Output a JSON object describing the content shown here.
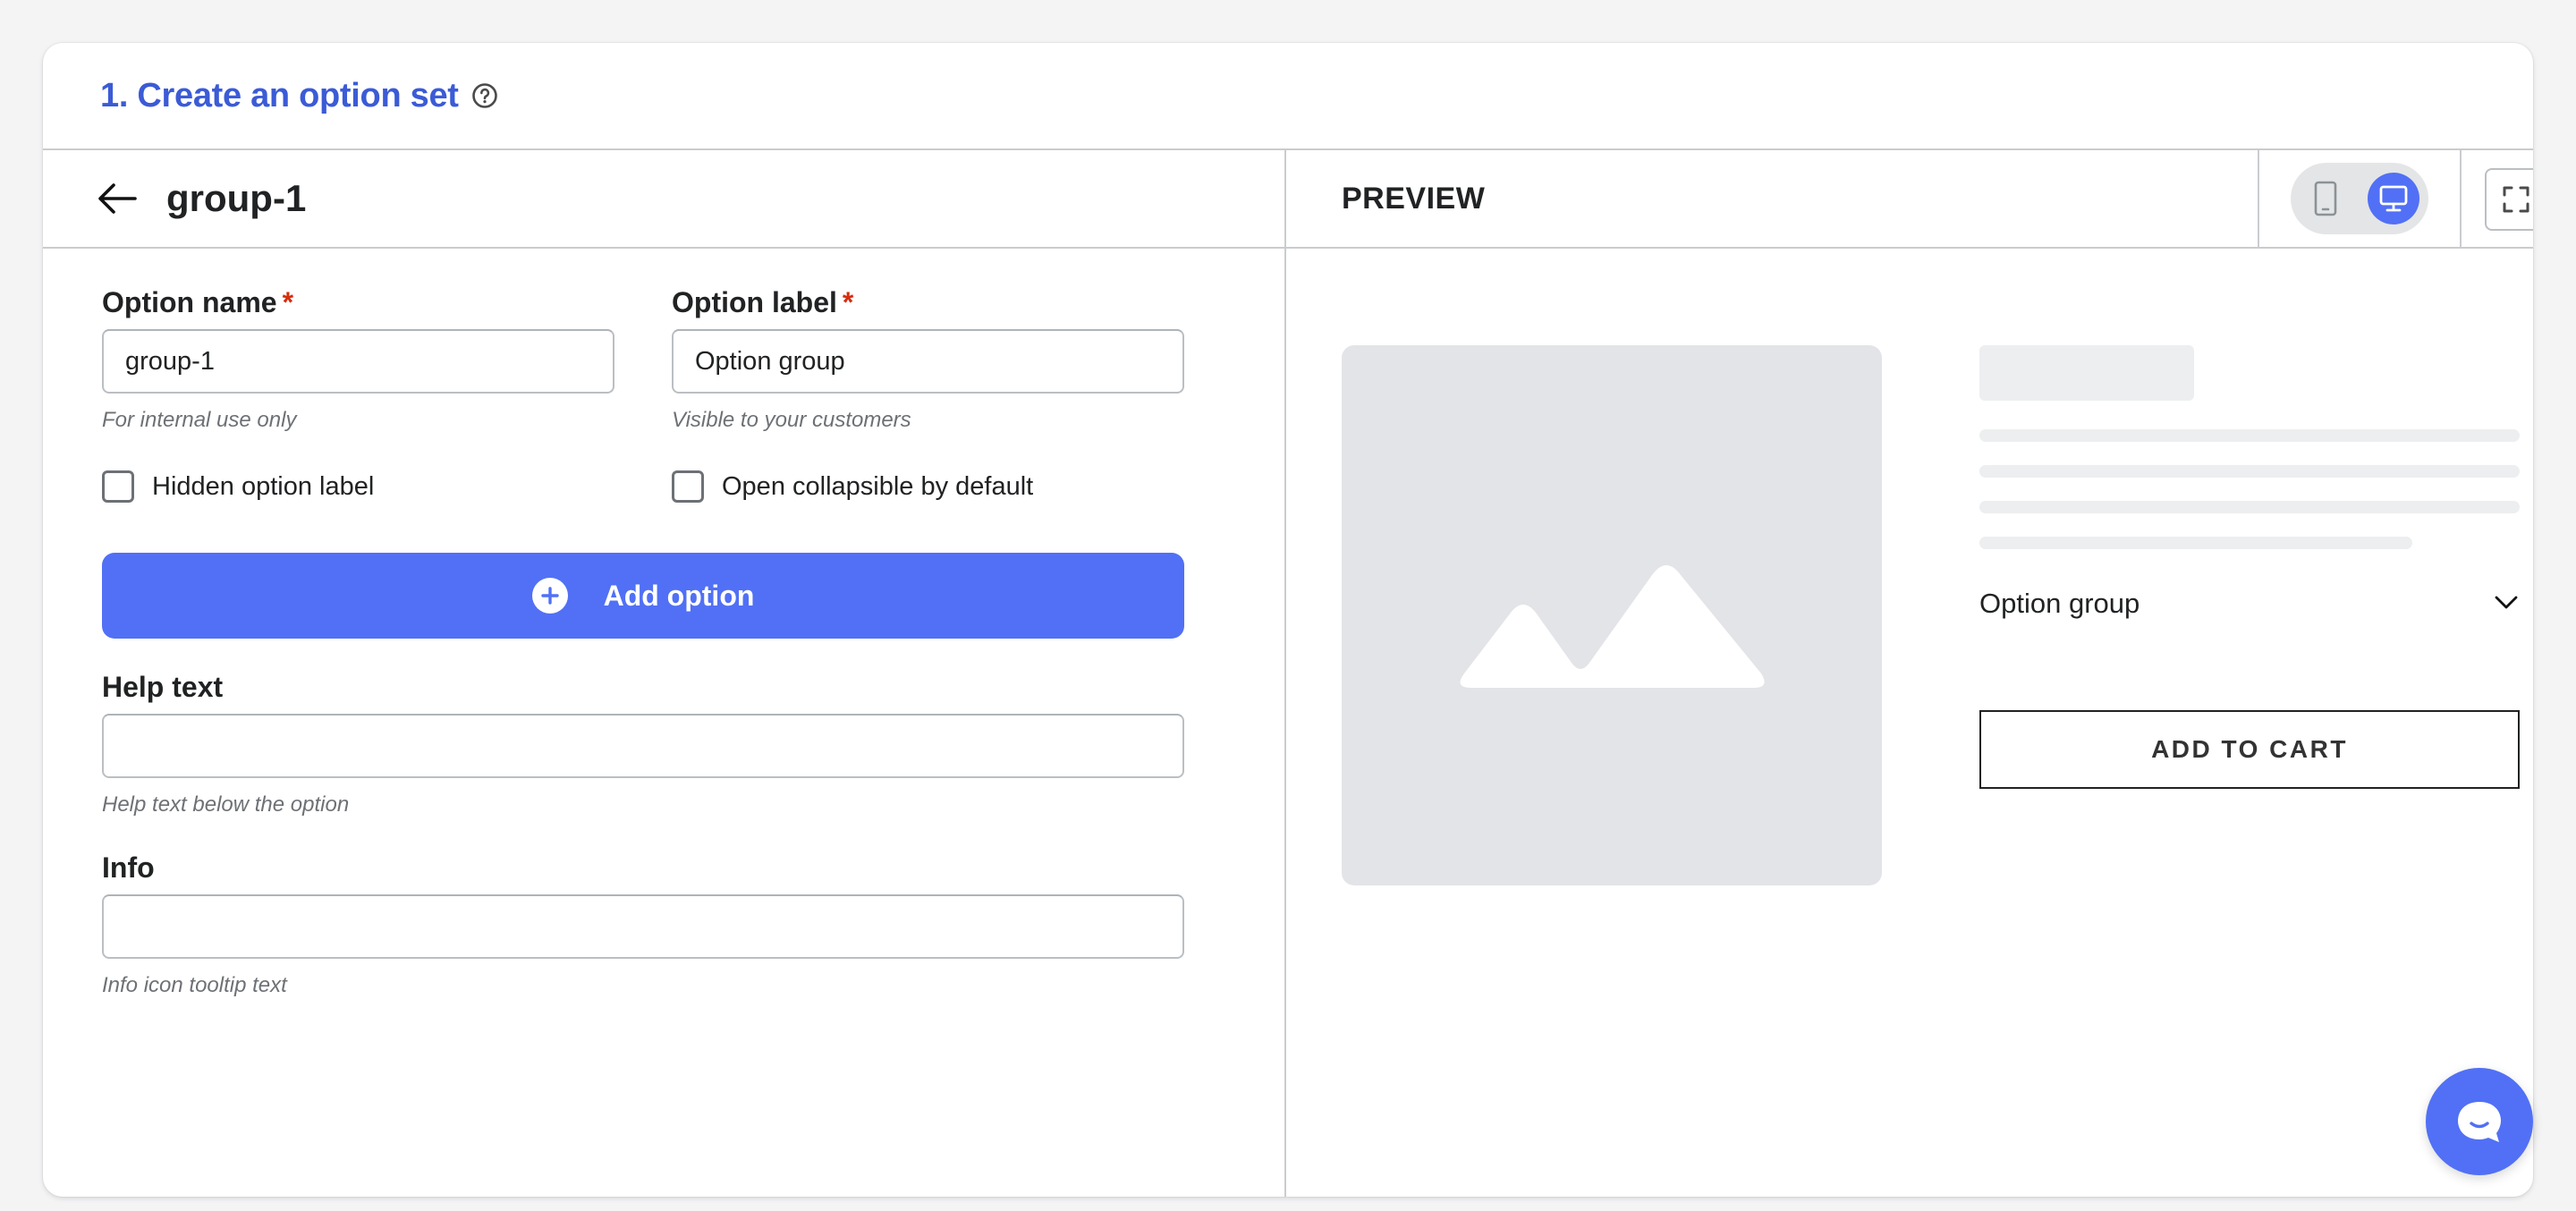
{
  "header": {
    "title": "1. Create an option set",
    "help_icon": "question-circle-icon"
  },
  "editor": {
    "back_icon": "arrow-left-icon",
    "group_title": "group-1",
    "option_name": {
      "label": "Option name",
      "required_mark": "*",
      "value": "group-1",
      "hint": "For internal use only"
    },
    "option_label": {
      "label": "Option label",
      "required_mark": "*",
      "value": "Option group",
      "hint": "Visible to your customers"
    },
    "hidden_label_checkbox": {
      "label": "Hidden option label",
      "checked": false
    },
    "collapsible_checkbox": {
      "label": "Open collapsible by default",
      "checked": false
    },
    "add_option_button": {
      "label": "Add option",
      "icon": "plus-circle-icon"
    },
    "help_text": {
      "label": "Help text",
      "value": "",
      "hint": "Help text below the option"
    },
    "info": {
      "label": "Info",
      "value": "",
      "hint": "Info icon tooltip text"
    }
  },
  "preview": {
    "title": "PREVIEW",
    "device_toggle": {
      "mobile_icon": "mobile-icon",
      "desktop_icon": "desktop-icon",
      "active": "desktop"
    },
    "fullscreen_icon": "expand-icon",
    "option_group_label": "Option group",
    "add_to_cart_label": "ADD TO CART"
  },
  "chat_icon": "chat-bubble-icon",
  "colors": {
    "accent": "#5170f5",
    "title": "#3b5bd6",
    "required": "#d72c0d"
  }
}
